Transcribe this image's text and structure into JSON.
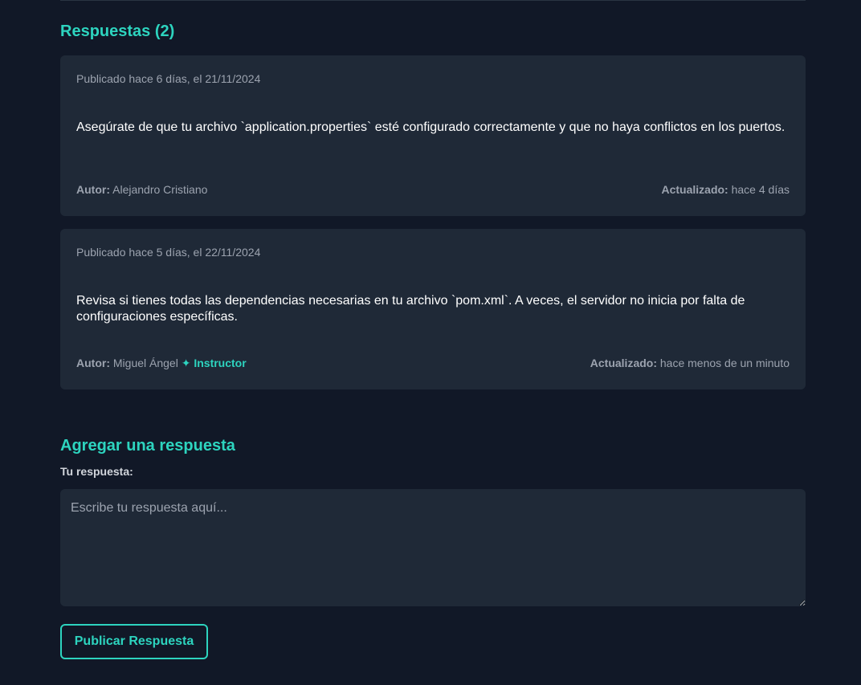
{
  "responses_section": {
    "title": "Respuestas (2)"
  },
  "replies": [
    {
      "published": "Publicado hace 6 días, el 21/11/2024",
      "body": "Asegúrate de que tu archivo `application.properties` esté configurado correctamente y que no haya conflictos en los puertos.",
      "author_label": "Autor:",
      "author": "Alejandro Cristiano",
      "badge": "",
      "updated_label": "Actualizado:",
      "updated": "hace 4 días"
    },
    {
      "published": "Publicado hace 5 días, el 22/11/2024",
      "body": "Revisa si tienes todas las dependencias necesarias en tu archivo `pom.xml`. A veces, el servidor no inicia por falta de configuraciones específicas.",
      "author_label": "Autor:",
      "author": "Miguel Ángel",
      "badge": "✦ Instructor",
      "updated_label": "Actualizado:",
      "updated": "hace menos de un minuto"
    }
  ],
  "add_reply": {
    "title": "Agregar una respuesta",
    "field_label": "Tu respuesta:",
    "placeholder": "Escribe tu respuesta aquí...",
    "value": "",
    "submit_label": "Publicar Respuesta"
  },
  "colors": {
    "background": "#111827",
    "card": "#1f2937",
    "accent": "#2dd4bf",
    "muted_text": "#9ca3af"
  }
}
